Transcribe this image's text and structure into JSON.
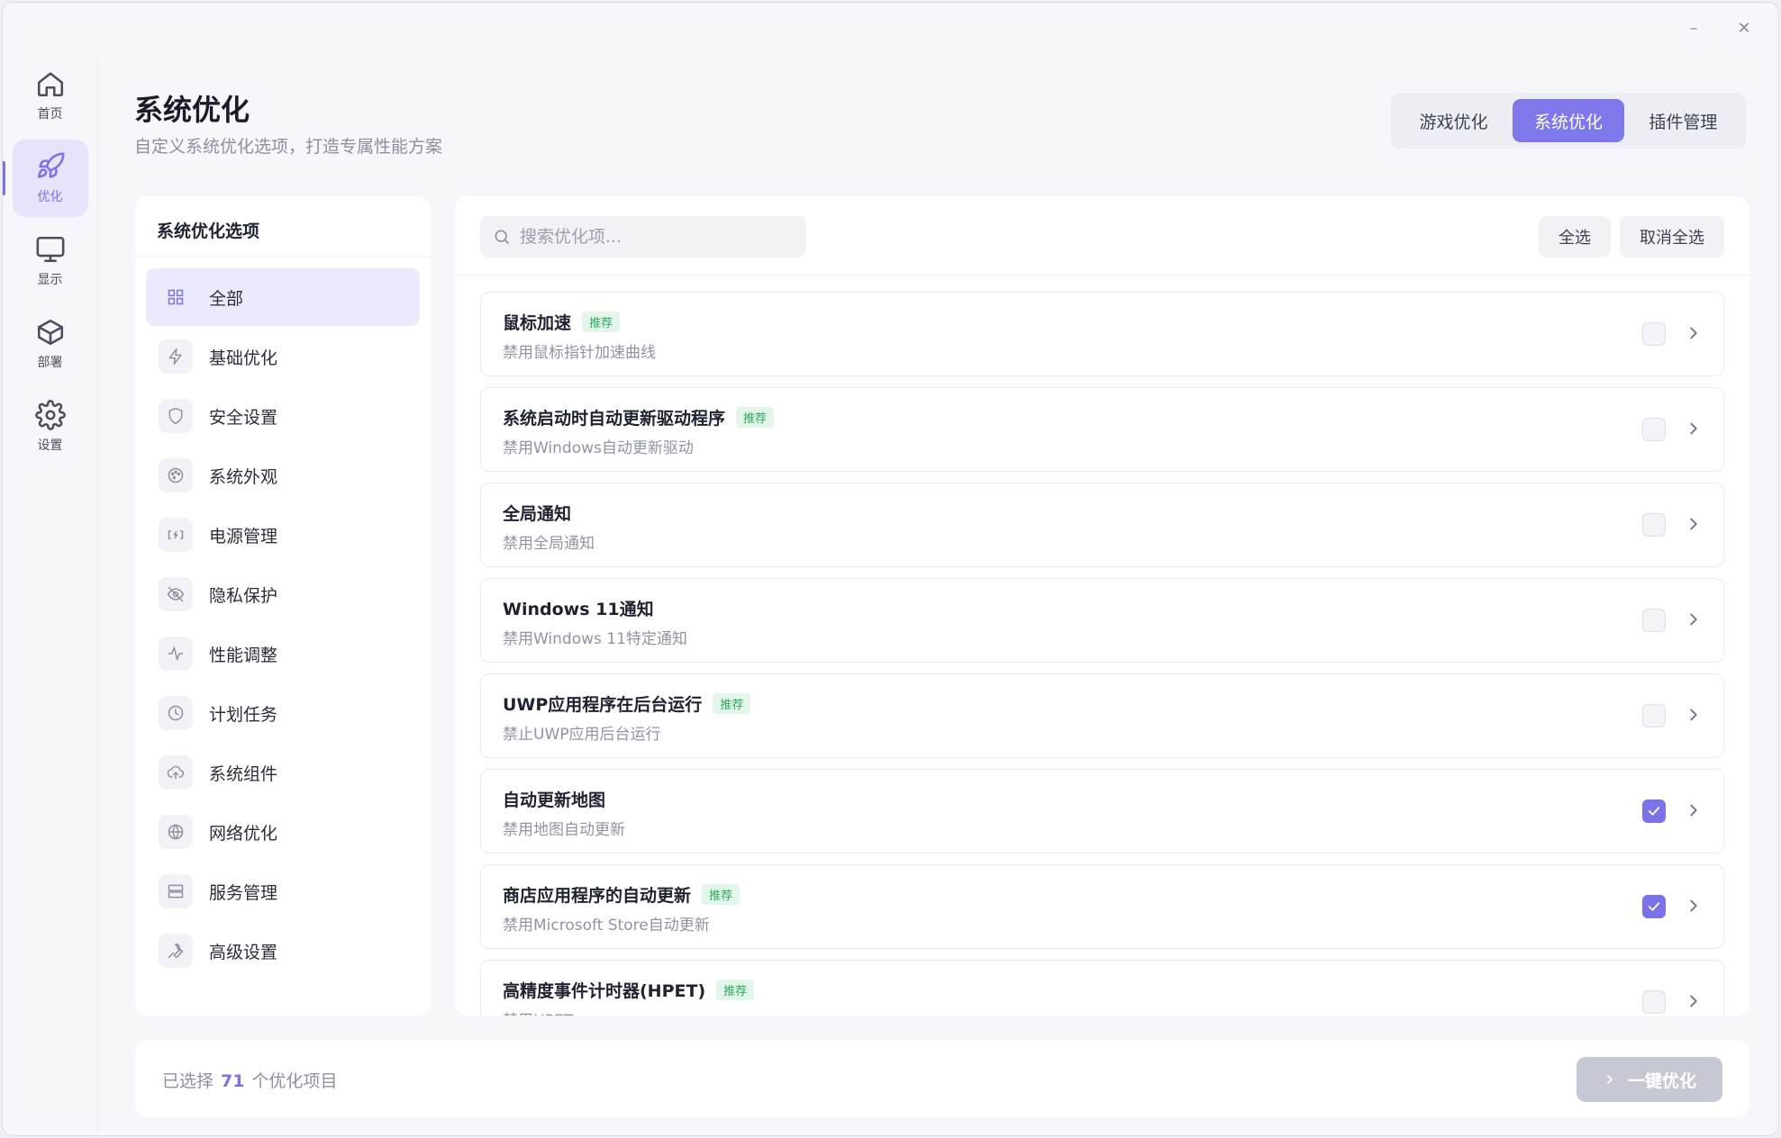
{
  "window": {
    "minimize_icon": "minimize-icon",
    "close_icon": "close-icon"
  },
  "rail": [
    {
      "label": "首页",
      "icon": "home-icon"
    },
    {
      "label": "优化",
      "icon": "rocket-icon",
      "active": true
    },
    {
      "label": "显示",
      "icon": "monitor-icon"
    },
    {
      "label": "部署",
      "icon": "box-icon"
    },
    {
      "label": "设置",
      "icon": "gear-icon"
    }
  ],
  "header": {
    "title": "系统优化",
    "subtitle": "自定义系统优化选项，打造专属性能方案",
    "tabs": [
      {
        "label": "游戏优化"
      },
      {
        "label": "系统优化",
        "active": true
      },
      {
        "label": "插件管理"
      }
    ]
  },
  "categories": {
    "heading": "系统优化选项",
    "items": [
      {
        "label": "全部",
        "icon": "grid-icon",
        "active": true
      },
      {
        "label": "基础优化",
        "icon": "lightning-icon"
      },
      {
        "label": "安全设置",
        "icon": "shield-icon"
      },
      {
        "label": "系统外观",
        "icon": "palette-icon"
      },
      {
        "label": "电源管理",
        "icon": "battery-icon"
      },
      {
        "label": "隐私保护",
        "icon": "eye-off-icon"
      },
      {
        "label": "性能调整",
        "icon": "activity-icon"
      },
      {
        "label": "计划任务",
        "icon": "clock-icon"
      },
      {
        "label": "系统组件",
        "icon": "cloud-icon"
      },
      {
        "label": "网络优化",
        "icon": "globe-icon"
      },
      {
        "label": "服务管理",
        "icon": "server-icon"
      },
      {
        "label": "高级设置",
        "icon": "wrench-icon"
      }
    ]
  },
  "toolbar": {
    "search_placeholder": "搜索优化项...",
    "select_all": "全选",
    "deselect_all": "取消全选"
  },
  "options": [
    {
      "title": "鼠标加速",
      "badge": "推荐",
      "desc": "禁用鼠标指针加速曲线",
      "checked": false
    },
    {
      "title": "系统启动时自动更新驱动程序",
      "badge": "推荐",
      "desc": "禁用Windows自动更新驱动",
      "checked": false
    },
    {
      "title": "全局通知",
      "badge": "",
      "desc": "禁用全局通知",
      "checked": false
    },
    {
      "title": "Windows 11通知",
      "badge": "",
      "desc": "禁用Windows 11特定通知",
      "checked": false
    },
    {
      "title": "UWP应用程序在后台运行",
      "badge": "推荐",
      "desc": "禁止UWP应用后台运行",
      "checked": false
    },
    {
      "title": "自动更新地图",
      "badge": "",
      "desc": "禁用地图自动更新",
      "checked": true
    },
    {
      "title": "商店应用程序的自动更新",
      "badge": "推荐",
      "desc": "禁用Microsoft Store自动更新",
      "checked": true
    },
    {
      "title": "高精度事件计时器(HPET)",
      "badge": "推荐",
      "desc": "禁用HPET",
      "checked": false
    }
  ],
  "footer": {
    "prefix": "已选择",
    "count": "71",
    "suffix": "个优化项目",
    "action_label": "一键优化"
  },
  "colors": {
    "accent": "#7b72e8",
    "badge_green": "#2eaa5f",
    "disabled_button": "#c6c9d3"
  }
}
